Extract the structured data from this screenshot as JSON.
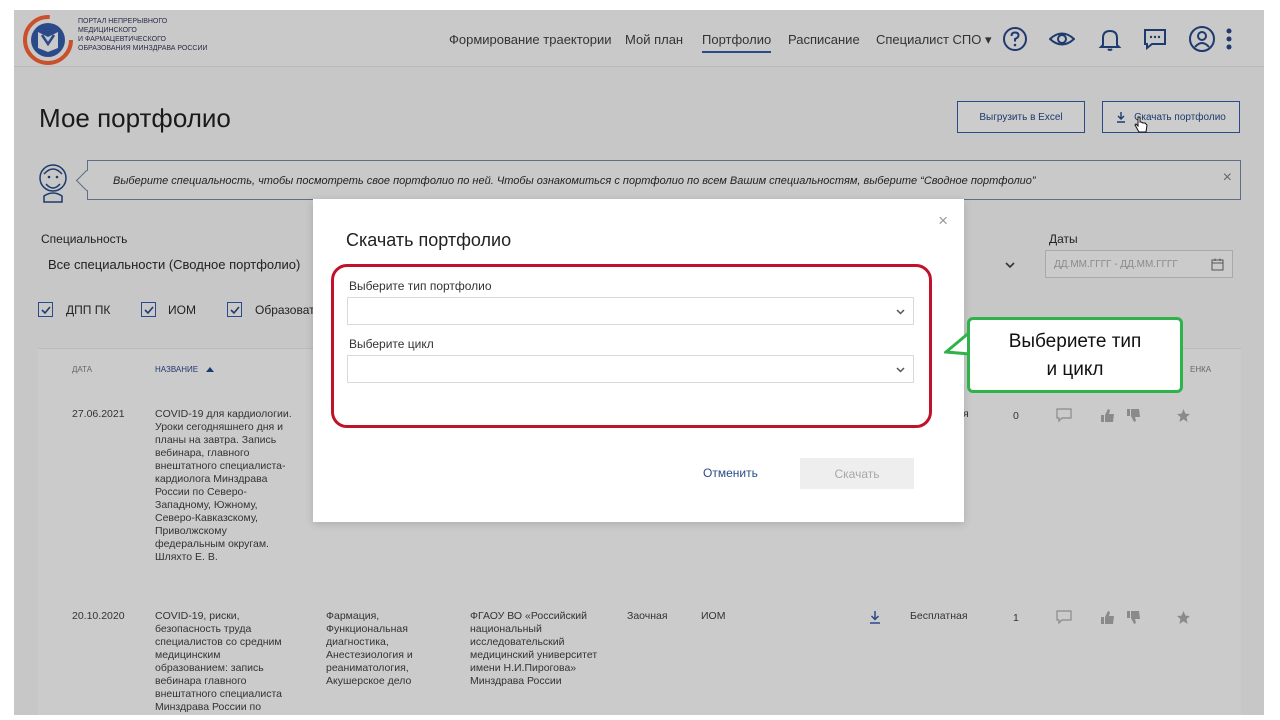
{
  "header": {
    "logo_lines": [
      "ПОРТАЛ НЕПРЕРЫВНОГО",
      "МЕДИЦИНСКОГО",
      "И ФАРМАЦЕВТИЧЕСКОГО",
      "ОБРАЗОВАНИЯ МИНЗДРАВА РОССИИ"
    ],
    "nav": [
      "Формирование траектории",
      "Мой план",
      "Портфолио",
      "Расписание",
      "Специалист СПО ▾"
    ],
    "active_nav": "Портфолио"
  },
  "page": {
    "title": "Мое портфолио",
    "export_button": "Выгрузить в Excel",
    "download_button": "Скачать портфолио"
  },
  "banner": {
    "text": "Выберите специальность, чтобы посмотреть свое портфолио по ней. Чтобы ознакомиться с портфолио по всем Вашим специальностям, выберите “Сводное портфолио”"
  },
  "filters": {
    "specialty_label": "Специальность",
    "specialty_value": "Все специальности (Сводное портфолио)",
    "dates_label": "Даты",
    "dates_placeholder": "ДД.ММ.ГГГГ - ДД.ММ.ГГГГ",
    "checkboxes": [
      "ДПП ПК",
      "ИОМ",
      "Образоват"
    ]
  },
  "table": {
    "headers": [
      "ДАТА",
      "НАЗВАНИЕ",
      "ЕНКА"
    ],
    "rows": [
      {
        "date": "27.06.2021",
        "title_lines": [
          "COVID-19 для кардиологии.",
          "Уроки сегодняшнего дня и",
          "планы на завтра. Запись",
          "вебинара, главного",
          "внештатного специалиста-",
          "кардиолога Минздрава",
          "России по Северо-",
          "Западному, Южному,",
          "Северо-Кавказскому,",
          "Приволжскому",
          "федеральным округам.",
          "Шляхто Е. В."
        ],
        "price_tail": "я",
        "count": "0"
      },
      {
        "date": "20.10.2020",
        "title_lines": [
          "COVID-19, риски,",
          "безопасность труда",
          "специалистов со средним",
          "медицинским",
          "образованием: запись",
          "вебинара главного",
          "внештатного специалиста",
          "Минздрава России по"
        ],
        "specialties_lines": [
          "Фармация,",
          "Функциональная",
          "диагностика,",
          "Анестезиология и",
          "реаниматология,",
          "Акушерское дело"
        ],
        "org_lines": [
          "ФГАОУ ВО «Российский",
          "национальный",
          "исследовательский",
          "медицинский университет",
          "имени Н.И.Пирогова»",
          "Минздрава России"
        ],
        "form": "Заочная",
        "type": "ИОМ",
        "price": "Бесплатная",
        "count": "1"
      }
    ]
  },
  "modal": {
    "title": "Скачать портфолио",
    "close": "×",
    "type_label": "Выберите тип портфолио",
    "type_value": "",
    "cycle_label": "Выберите цикл",
    "cycle_value": "",
    "cancel": "Отменить",
    "download": "Скачать"
  },
  "callout": {
    "text_line1": "Выбериете тип",
    "text_line2": "и цикл"
  }
}
